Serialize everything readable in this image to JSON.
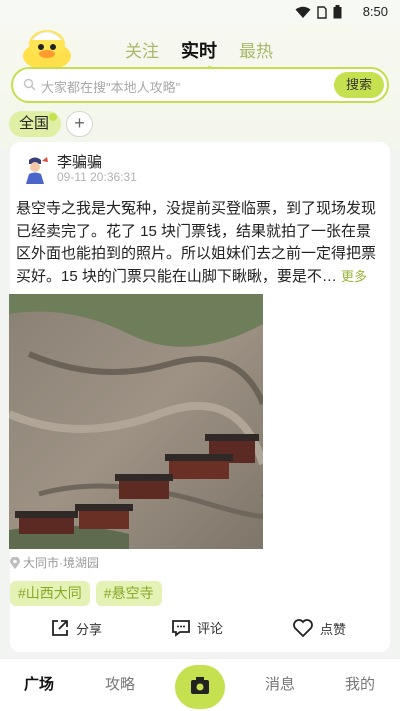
{
  "status_bar": {
    "time": "8:50"
  },
  "header": {
    "tabs": [
      {
        "label": "关注"
      },
      {
        "label": "实时"
      },
      {
        "label": "最热"
      }
    ],
    "active_tab": "实时"
  },
  "search": {
    "placeholder": "大家都在搜\"本地人攻略\"",
    "button_label": "搜索"
  },
  "region": {
    "selected": "全国",
    "add_label": "+"
  },
  "post": {
    "author": "李骗骗",
    "time": "09-11 20:36:31",
    "text": "悬空寺之我是大冤种，没提前买登临票，到了现场发现已经卖完了。花了 15 块门票钱，结果就拍了一张在景区外面也能拍到的照片。所以姐妹们去之前一定得把票买好。15 块的门票只能在山脚下瞅瞅，要是不…",
    "more_label": "更多",
    "location": "大同市·境湖园",
    "tags": [
      "#山西大同",
      "#悬空寺"
    ],
    "actions": {
      "share": "分享",
      "comment": "评论",
      "like": "点赞"
    }
  },
  "bottom_nav": {
    "items": [
      "广场",
      "攻略",
      "消息",
      "我的"
    ],
    "active": "广场"
  },
  "colors": {
    "accent": "#c6e14f",
    "tag_bg": "#e4f2b6",
    "tag_text": "#88a827",
    "more_text": "#9bb33a"
  }
}
